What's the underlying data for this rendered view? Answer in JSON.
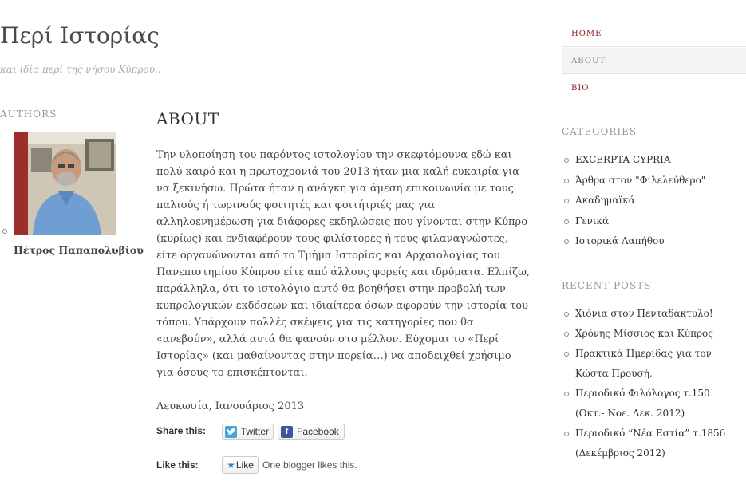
{
  "site": {
    "title": "Περί Ιστορίας",
    "description": "και ιδία περί της νήσου Κύπρου.."
  },
  "authors": {
    "heading": "AUTHORS",
    "name": "Πέτρος Παπαπολυβίου"
  },
  "page": {
    "title": "ABOUT",
    "paragraphs": [
      "Την υλοποίηση του παρόντος ιστολογίου την σκεφτόμουνα εδώ και πολύ καιρό και η πρωτοχρονιά του 2013 ήταν μια καλή ευκαιρία για να ξεκινήσω. Πρώτα ήταν η ανάγκη για άμεση επικοινωνία με τους παλιούς ή τωρινούς φοιτητές και φοιτήτριές μας για αλληλοενημέρωση για διάφορες εκδηλώσεις που γίνονται στην Κύπρο (κυρίως) και ενδιαφέρουν τους φιλίστορες ή τους φιλαναγνώστες, είτε οργανώνονται από το Τμήμα Ιστορίας και Αρχαιολογίας του Πανεπιστημίου Κύπρου είτε από άλλους φορείς και ιδρύματα. Ελπίζω, παράλληλα, ότι το ιστολόγιο αυτό θα βοηθήσει στην προβολή των κυπρολογικών εκδόσεων και ιδιαίτερα όσων αφορούν την ιστορία του τόπου. Υπάρχουν πολλές σκέψεις για τις κατηγορίες που θα «ανεβούν», αλλά αυτά θα φανούν στο μέλλον. Εύχομαι το «Περί Ιστορίας» (και μαθαίνοντας στην πορεία…) να αποδειχθεί χρήσιμο για όσους το επισκέπτονται.",
      "Λευκωσία, Ιανουάριος 2013"
    ]
  },
  "share": {
    "label": "Share this:",
    "twitter": "Twitter",
    "facebook": "Facebook"
  },
  "like": {
    "label": "Like this:",
    "button": "Like",
    "count_text": "One blogger likes this."
  },
  "nav": {
    "items": [
      {
        "label": "HOME"
      },
      {
        "label": "ABOUT"
      },
      {
        "label": "BIO"
      }
    ]
  },
  "categories": {
    "heading": "CATEGORIES",
    "items": [
      "EXCERPTA CYPRIA",
      "Άρθρα στον \"Φιλελεύθερο\"",
      "Ακαδημαϊκά",
      "Γενικά",
      "Ιστορικά Λαπήθου"
    ]
  },
  "recent_posts": {
    "heading": "RECENT POSTS",
    "items": [
      "Χιόνια στον Πενταδάκτυλο!",
      "Χρόνης Μίσσιος και Κύπρος",
      "Πρακτικά Ημερίδας για τον Κώστα Προυσή,",
      "Περιοδικό Φιλόλογος τ.150 (Οκτ.- Νοε. Δεκ. 2012)",
      "Περιοδικό “Νέα Εστία” τ.1856 (Δεκέμβριος 2012)"
    ]
  },
  "colors": {
    "accent": "#8b1a1a",
    "muted": "#999999",
    "twitter": "#4aa3df",
    "facebook": "#3b5998"
  },
  "icons": [
    "twitter-icon",
    "facebook-icon",
    "star-icon"
  ]
}
